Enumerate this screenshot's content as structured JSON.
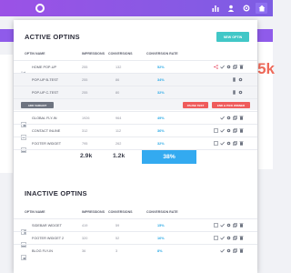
{
  "colors": {
    "brand": "#8f5bea",
    "accent": "#41c7c7",
    "rate": "#2ba9e6",
    "danger": "#ef5b5b",
    "share": "#e84d66"
  },
  "background_stat": "5k",
  "active": {
    "title": "ACTIVE OPTINS",
    "new_button": "NEW OPTIN",
    "headers": {
      "name": "OPTIN NAME",
      "impressions": "IMPRESSIONS",
      "conversions": "CONVERSIONS",
      "rate": "CONVERSION RATE"
    },
    "rows": [
      {
        "name": "HOME POP-UP",
        "impressions": "255",
        "conversions": "132",
        "rate": "52%",
        "split": false
      },
      {
        "name": "POP-UP B-TEST",
        "impressions": "255",
        "conversions": "86",
        "rate": "34%",
        "split": true
      },
      {
        "name": "POP-UP C-TEST",
        "impressions": "255",
        "conversions": "80",
        "rate": "32%",
        "split": true
      }
    ],
    "split_actions": {
      "add_variant": "ADD VARIANT",
      "pause_test": "PAUSE TEST",
      "end_pick": "END & PICK WINNER"
    },
    "rows2": [
      {
        "name": "GLOBAL FLY-IN",
        "impressions": "1926",
        "conversions": "964",
        "rate": "49%"
      },
      {
        "name": "CONTACT INLINE",
        "impressions": "312",
        "conversions": "112",
        "rate": "36%"
      },
      {
        "name": "FOOTER WIDGET",
        "impressions": "795",
        "conversions": "262",
        "rate": "32%"
      }
    ],
    "totals": {
      "impressions": "2.9k",
      "conversions": "1.2k",
      "rate": "38%"
    }
  },
  "inactive": {
    "title": "INACTIVE OPTINS",
    "headers": {
      "name": "OPTIN NAME",
      "impressions": "IMPRESSIONS",
      "conversions": "CONVERSIONS",
      "rate": "CONVERSION RATE"
    },
    "rows": [
      {
        "name": "SIDEBAR WIDGET",
        "impressions": "419",
        "conversions": "59",
        "rate": "15%"
      },
      {
        "name": "FOOTER WIDGET 2",
        "impressions": "320",
        "conversions": "52",
        "rate": "16%"
      },
      {
        "name": "BLOG FLY-IN",
        "impressions": "36",
        "conversions": "3",
        "rate": "8%"
      }
    ]
  }
}
